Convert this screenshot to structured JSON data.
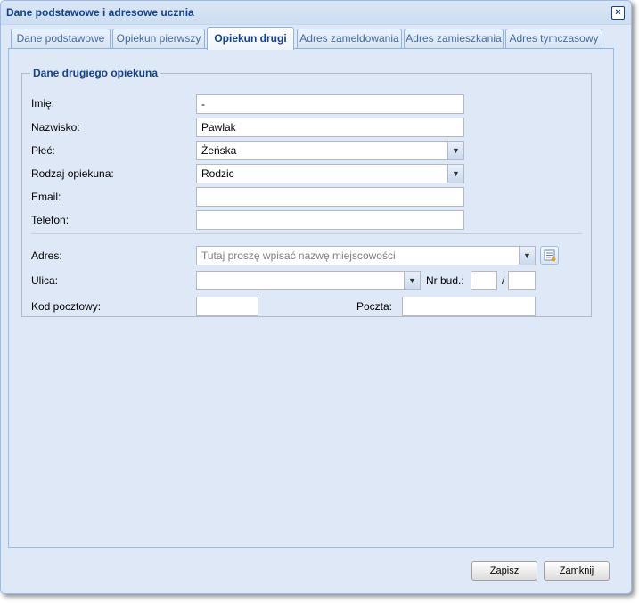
{
  "window": {
    "title": "Dane podstawowe i adresowe ucznia",
    "close_label": "×"
  },
  "tabs": [
    {
      "label": "Dane podstawowe"
    },
    {
      "label": "Opiekun pierwszy"
    },
    {
      "label": "Opiekun drugi",
      "active": true
    },
    {
      "label": "Adres zameldowania"
    },
    {
      "label": "Adres zamieszkania"
    },
    {
      "label": "Adres tymczasowy"
    }
  ],
  "fieldset": {
    "legend": "Dane drugiego opiekuna"
  },
  "form": {
    "imie": {
      "label": "Imię:",
      "value": "-"
    },
    "nazwisko": {
      "label": "Nazwisko:",
      "value": "Pawlak"
    },
    "plec": {
      "label": "Płeć:",
      "value": "Żeńska"
    },
    "rodzaj": {
      "label": "Rodzaj opiekuna:",
      "value": "Rodzic"
    },
    "email": {
      "label": "Email:",
      "value": ""
    },
    "telefon": {
      "label": "Telefon:",
      "value": ""
    },
    "adres": {
      "label": "Adres:",
      "placeholder": "Tutaj proszę wpisać nazwę miejscowości"
    },
    "ulica": {
      "label": "Ulica:",
      "value": ""
    },
    "nr_bud": {
      "label": "Nr bud.:",
      "value": "",
      "separator": "/",
      "lokal": ""
    },
    "kod": {
      "label": "Kod pocztowy:",
      "value": ""
    },
    "poczta": {
      "label": "Poczta:",
      "value": ""
    }
  },
  "buttons": {
    "save": "Zapisz",
    "close": "Zamknij"
  },
  "icons": {
    "dropdown": "chevron-down-icon",
    "address_picker": "address-book-icon"
  }
}
